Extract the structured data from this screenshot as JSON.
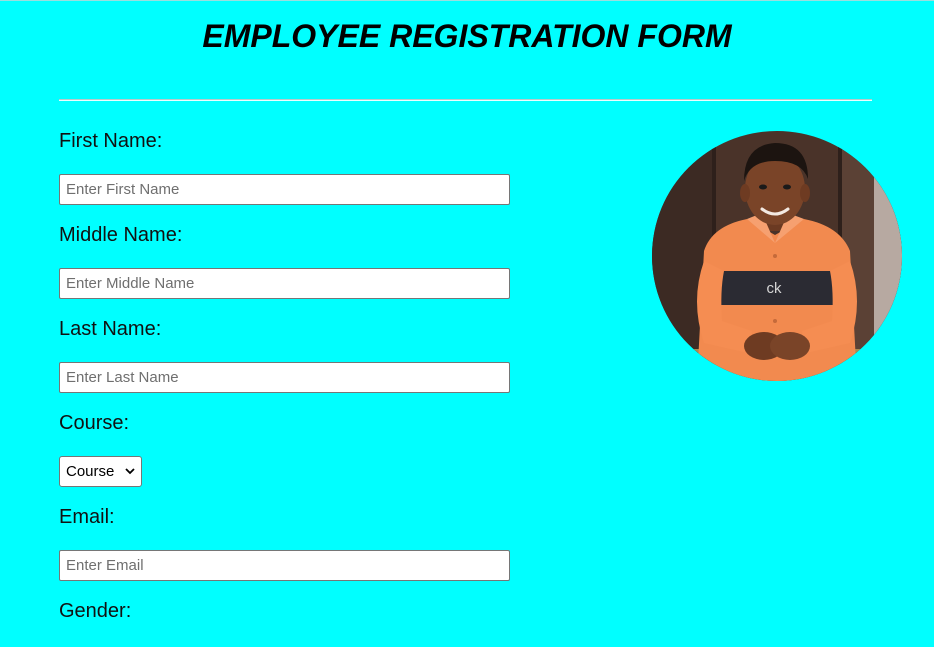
{
  "title": "EMPLOYEE REGISTRATION FORM",
  "form": {
    "first_name": {
      "label": "First Name:",
      "placeholder": "Enter First Name",
      "value": ""
    },
    "middle_name": {
      "label": "Middle Name:",
      "placeholder": "Enter Middle Name",
      "value": ""
    },
    "last_name": {
      "label": "Last Name:",
      "placeholder": "Enter Last Name",
      "value": ""
    },
    "course": {
      "label": "Course:",
      "selected": "Course"
    },
    "email": {
      "label": "Email:",
      "placeholder": "Enter Email",
      "value": ""
    },
    "gender": {
      "label": "Gender:"
    }
  },
  "photo": {
    "icon": "profile-photo",
    "logo_text": "ck"
  },
  "colors": {
    "background": "#00ffff",
    "shirt": "#f28a4f",
    "stripe": "#2b2b33"
  }
}
